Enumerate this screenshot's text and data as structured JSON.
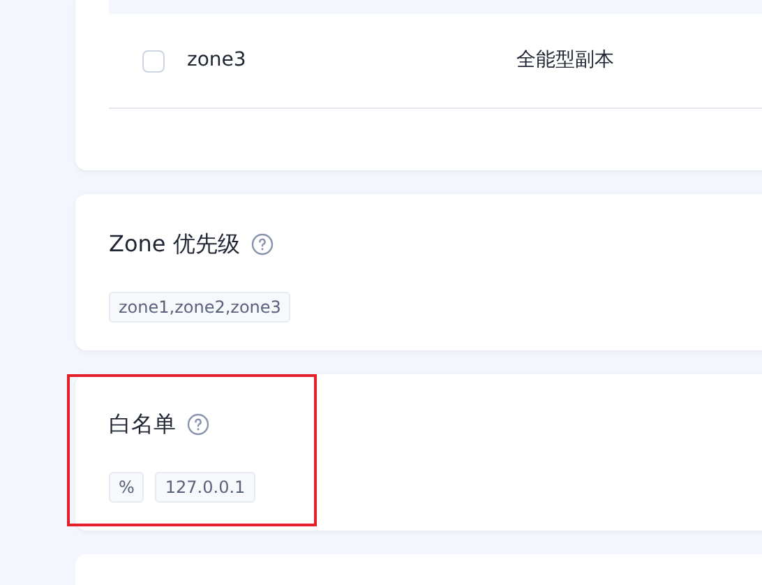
{
  "table": {
    "rows": [
      {
        "checked": false,
        "cells": [
          "zone3",
          "全能型副本"
        ]
      }
    ]
  },
  "sections": [
    {
      "title": "Zone 优先级",
      "tags": [
        "zone1,zone2,zone3"
      ],
      "highlighted": false
    },
    {
      "title": "白名单",
      "tags": [
        "%",
        "127.0.0.1"
      ],
      "highlighted": true
    }
  ]
}
